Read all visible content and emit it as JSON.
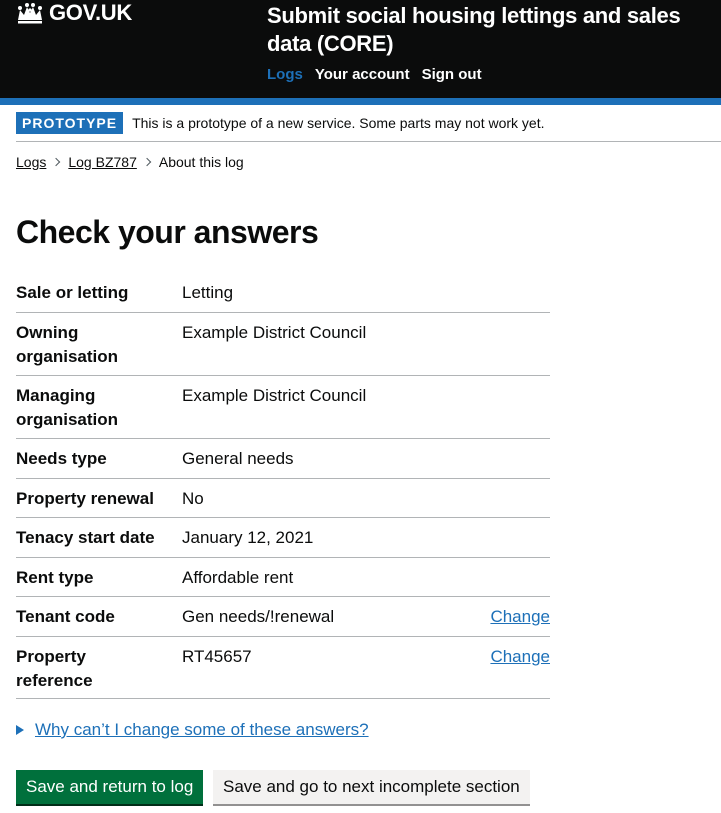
{
  "header": {
    "logo_text": "GOV.UK",
    "service_name": "Submit social housing lettings and sales data (CORE)",
    "nav": [
      {
        "label": "Logs",
        "active": true
      },
      {
        "label": "Your account",
        "active": false
      },
      {
        "label": "Sign out",
        "active": false
      }
    ]
  },
  "phase_banner": {
    "tag": "PROTOTYPE",
    "text": "This is a prototype of a new service. Some parts may not work yet."
  },
  "breadcrumb": {
    "items": [
      "Logs",
      "Log BZ787"
    ],
    "current": "About this log"
  },
  "page_title": "Check your answers",
  "summary_rows": [
    {
      "key": "Sale or letting",
      "value": "Letting",
      "action": ""
    },
    {
      "key": "Owning organisation",
      "value": "Example District Council",
      "action": ""
    },
    {
      "key": "Managing organisation",
      "value": "Example District Council",
      "action": ""
    },
    {
      "key": "Needs type",
      "value": "General needs",
      "action": ""
    },
    {
      "key": "Property renewal",
      "value": "No",
      "action": ""
    },
    {
      "key": "Tenacy start date",
      "value": "January 12, 2021",
      "action": ""
    },
    {
      "key": "Rent type",
      "value": "Affordable rent",
      "action": ""
    },
    {
      "key": "Tenant code",
      "value": "Gen needs/!renewal",
      "action": "Change"
    },
    {
      "key": "Property reference",
      "value": "RT45657",
      "action": "Change"
    }
  ],
  "details": {
    "summary": "Why can’t I change some of these answers?"
  },
  "buttons": {
    "primary": "Save and return to log",
    "secondary": "Save and go to next incomplete section"
  },
  "colors": {
    "header_bg": "#0b0c0c",
    "brand_blue": "#1d70b8",
    "primary_green": "#00703c",
    "secondary_grey": "#f3f2f1",
    "border_grey": "#b1b4b6"
  },
  "icons": {
    "logo": "crown-icon",
    "breadcrumb_separator": "chevron-right-icon",
    "details_toggle": "triangle-right-icon"
  }
}
